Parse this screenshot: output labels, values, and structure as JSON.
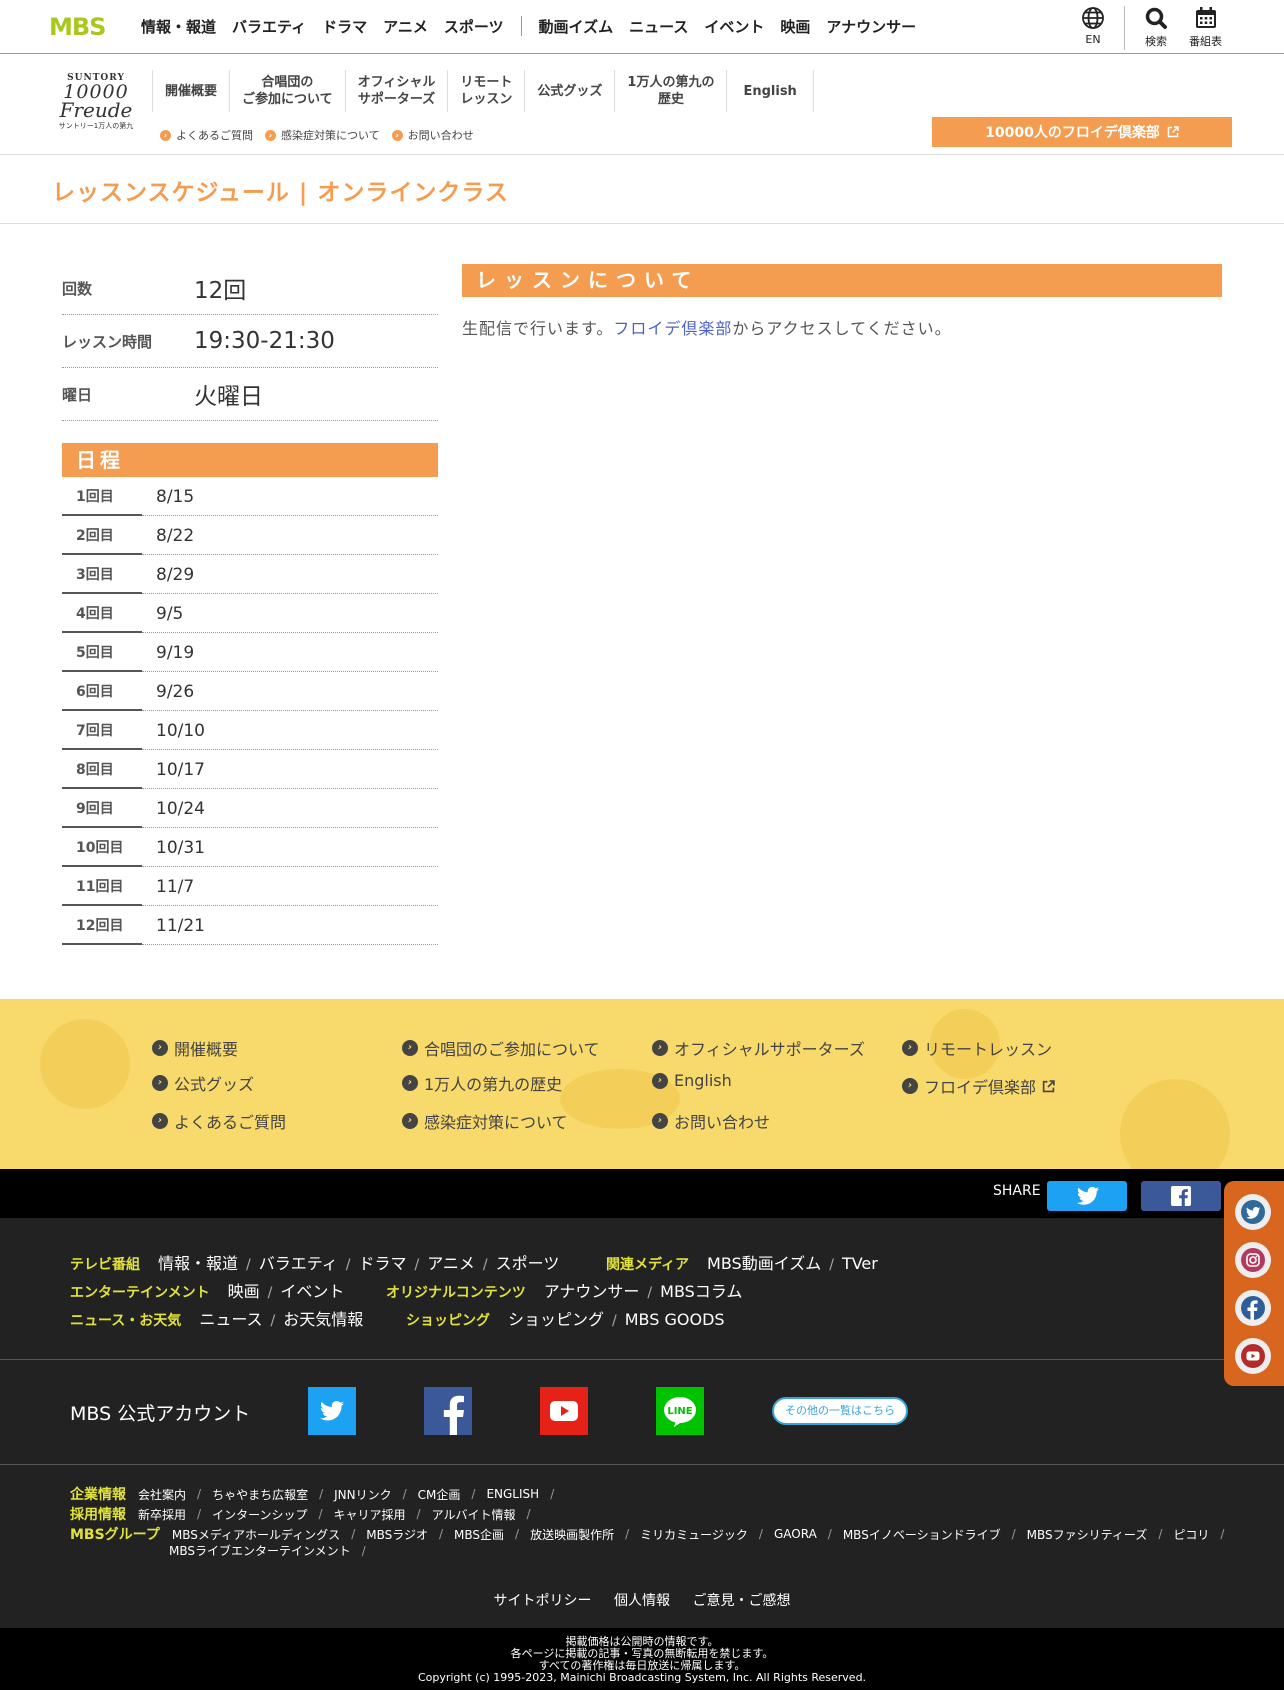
{
  "header": {
    "logo": "MBS",
    "nav": [
      "情報・報道",
      "バラエティ",
      "ドラマ",
      "アニメ",
      "スポーツ"
    ],
    "nav2": [
      "動画イズム",
      "ニュース",
      "イベント",
      "映画",
      "アナウンサー"
    ],
    "lang_label": "EN",
    "search_label": "検索",
    "schedule_label": "番組表"
  },
  "subheader": {
    "logo": {
      "line1": "SUNTORY",
      "line2": "10000",
      "line3": "Freude",
      "line4": "サントリー1万人の第九"
    },
    "nav": [
      {
        "line1": "開催概要",
        "line2": ""
      },
      {
        "line1": "合唱団の",
        "line2": "ご参加について"
      },
      {
        "line1": "オフィシャル",
        "line2": "サポーターズ"
      },
      {
        "line1": "リモート",
        "line2": "レッスン"
      },
      {
        "line1": "公式グッズ",
        "line2": ""
      },
      {
        "line1": "1万人の第九の",
        "line2": "歴史"
      },
      {
        "line1": "English",
        "line2": ""
      }
    ],
    "links": [
      "よくあるご質問",
      "感染症対策について",
      "お問い合わせ"
    ],
    "club_button": "10000人のフロイデ倶楽部"
  },
  "page": {
    "title": "レッスンスケジュール | オンラインクラス"
  },
  "info": {
    "rows": [
      {
        "key": "回数",
        "value": "12回"
      },
      {
        "key": "レッスン時間",
        "value": "19:30-21:30"
      },
      {
        "key": "曜日",
        "value": "火曜日"
      }
    ]
  },
  "schedule": {
    "heading": "日程",
    "rows": [
      {
        "n": "1回目",
        "date": "8/15"
      },
      {
        "n": "2回目",
        "date": "8/22"
      },
      {
        "n": "3回目",
        "date": "8/29"
      },
      {
        "n": "4回目",
        "date": "9/5"
      },
      {
        "n": "5回目",
        "date": "9/19"
      },
      {
        "n": "6回目",
        "date": "9/26"
      },
      {
        "n": "7回目",
        "date": "10/10"
      },
      {
        "n": "8回目",
        "date": "10/17"
      },
      {
        "n": "9回目",
        "date": "10/24"
      },
      {
        "n": "10回目",
        "date": "10/31"
      },
      {
        "n": "11回目",
        "date": "11/7"
      },
      {
        "n": "12回目",
        "date": "11/21"
      }
    ]
  },
  "lesson": {
    "heading": "レッスンについて",
    "text_before": "生配信で行います。",
    "link": "フロイデ倶楽部",
    "text_after": "からアクセスしてください。"
  },
  "footer_nav": {
    "row1": [
      "開催概要",
      "合唱団のご参加について",
      "オフィシャルサポーターズ",
      "リモートレッスン"
    ],
    "row2": [
      "公式グッズ",
      "1万人の第九の歴史",
      "English",
      "フロイデ倶楽部"
    ],
    "row3": [
      "よくあるご質問",
      "感染症対策について",
      "お問い合わせ"
    ]
  },
  "share": {
    "label": "SHARE"
  },
  "footer": {
    "tv": {
      "cat": "テレビ番組",
      "items": [
        "情報・報道",
        "バラエティ",
        "ドラマ",
        "アニメ",
        "スポーツ"
      ]
    },
    "media": {
      "cat": "関連メディア",
      "items": [
        "MBS動画イズム",
        "TVer"
      ]
    },
    "ent": {
      "cat": "エンターテインメント",
      "items": [
        "映画",
        "イベント"
      ]
    },
    "orig": {
      "cat": "オリジナルコンテンツ",
      "items": [
        "アナウンサー",
        "MBSコラム"
      ]
    },
    "news": {
      "cat": "ニュース・お天気",
      "items": [
        "ニュース",
        "お天気情報"
      ]
    },
    "shop": {
      "cat": "ショッピング",
      "items": [
        "ショッピング",
        "MBS GOODS"
      ]
    },
    "accounts_label": "MBS 公式アカウント",
    "others_button": "その他の一覧はこちら",
    "corp": {
      "cat": "企業情報",
      "items": [
        "会社案内",
        "ちゃやまち広報室",
        "JNNリンク",
        "CM企画",
        "ENGLISH"
      ]
    },
    "recruit": {
      "cat": "採用情報",
      "items": [
        "新卒採用",
        "インターンシップ",
        "キャリア採用",
        "アルバイト情報"
      ]
    },
    "group": {
      "cat": "MBSグループ",
      "items": [
        "MBSメディアホールディングス",
        "MBSラジオ",
        "MBS企画",
        "放送映画製作所",
        "ミリカミュージック",
        "GAORA",
        "MBSイノベーションドライブ",
        "MBSファシリティーズ",
        "ピコリ"
      ],
      "items2": [
        "MBSライブエンターテインメント"
      ]
    },
    "policy": [
      "サイトポリシー",
      "個人情報",
      "ご意見・ご感想"
    ]
  },
  "copyright": {
    "line1": "掲載価格は公開時の情報です。",
    "line2": "各ページに掲載の記事・写真の無断転用を禁じます。",
    "line3": "すべての著作権は毎日放送に帰属します。",
    "line4": "Copyright (c) 1995-2023, Mainichi Broadcasting System, Inc. All Rights Reserved."
  },
  "colors": {
    "accent": "#f49c50",
    "yellow": "#f8d96b",
    "footer_cat": "#e1e23b",
    "link": "#4d62c9"
  }
}
